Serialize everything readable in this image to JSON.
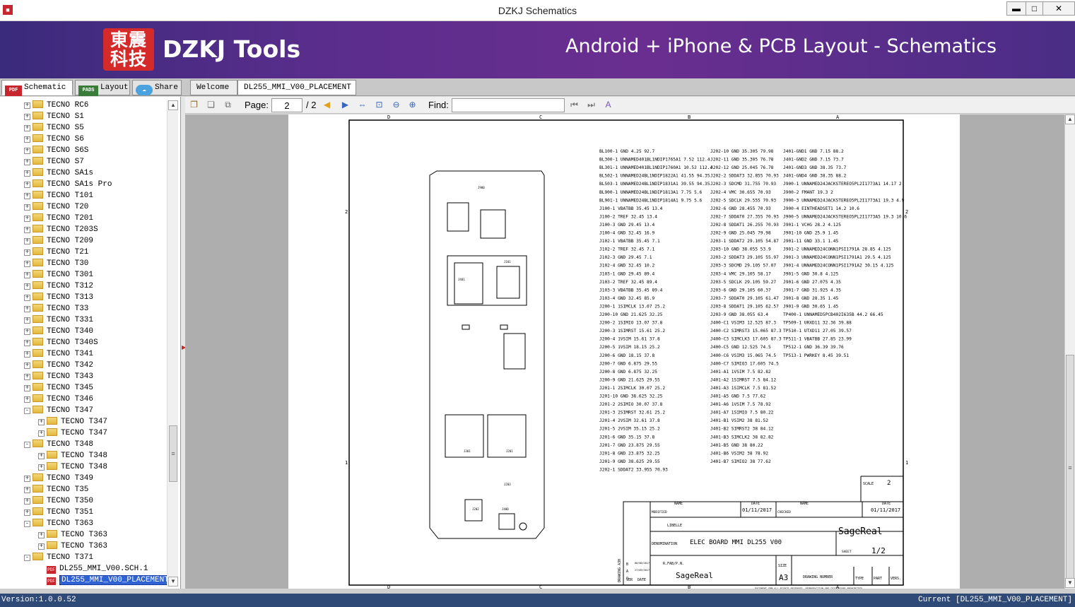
{
  "window": {
    "title": "DZKJ Schematics",
    "app_icon": "app-logo-icon",
    "minimize": "▬",
    "maximize": "□",
    "close": "✕"
  },
  "banner": {
    "logo": "東震\n科技",
    "brand": "DZKJ Tools",
    "tagline": "Android + iPhone & PCB Layout - Schematics"
  },
  "left_tabs": [
    {
      "label": "Schematic",
      "icon": "PDF",
      "active": true
    },
    {
      "label": "Layout",
      "icon": "PADS",
      "active": false
    },
    {
      "label": "Share",
      "icon": "cloud",
      "active": false
    }
  ],
  "doc_tabs": [
    {
      "label": "Welcome",
      "active": false
    },
    {
      "label": "DL255_MMI_V00_PLACEMENT",
      "active": true
    }
  ],
  "tree": [
    {
      "label": "TECNO RC6",
      "level": 0,
      "expander": "+",
      "icon": "folder"
    },
    {
      "label": "TECNO S1",
      "level": 0,
      "expander": "+",
      "icon": "folder"
    },
    {
      "label": "TECNO S5",
      "level": 0,
      "expander": "+",
      "icon": "folder"
    },
    {
      "label": "TECNO S6",
      "level": 0,
      "expander": "+",
      "icon": "folder"
    },
    {
      "label": "TECNO S6S",
      "level": 0,
      "expander": "+",
      "icon": "folder"
    },
    {
      "label": "TECNO S7",
      "level": 0,
      "expander": "+",
      "icon": "folder"
    },
    {
      "label": "TECNO SA1s",
      "level": 0,
      "expander": "+",
      "icon": "folder"
    },
    {
      "label": "TECNO SA1s Pro",
      "level": 0,
      "expander": "+",
      "icon": "folder"
    },
    {
      "label": "TECNO T101",
      "level": 0,
      "expander": "+",
      "icon": "folder"
    },
    {
      "label": "TECNO T20",
      "level": 0,
      "expander": "+",
      "icon": "folder"
    },
    {
      "label": "TECNO T201",
      "level": 0,
      "expander": "+",
      "icon": "folder"
    },
    {
      "label": "TECNO T203S",
      "level": 0,
      "expander": "+",
      "icon": "folder"
    },
    {
      "label": "TECNO T209",
      "level": 0,
      "expander": "+",
      "icon": "folder"
    },
    {
      "label": "TECNO T21",
      "level": 0,
      "expander": "+",
      "icon": "folder"
    },
    {
      "label": "TECNO T30",
      "level": 0,
      "expander": "+",
      "icon": "folder"
    },
    {
      "label": "TECNO T301",
      "level": 0,
      "expander": "+",
      "icon": "folder"
    },
    {
      "label": "TECNO T312",
      "level": 0,
      "expander": "+",
      "icon": "folder"
    },
    {
      "label": "TECNO T313",
      "level": 0,
      "expander": "+",
      "icon": "folder"
    },
    {
      "label": "TECNO T33",
      "level": 0,
      "expander": "+",
      "icon": "folder"
    },
    {
      "label": "TECNO T331",
      "level": 0,
      "expander": "+",
      "icon": "folder"
    },
    {
      "label": "TECNO T340",
      "level": 0,
      "expander": "+",
      "icon": "folder"
    },
    {
      "label": "TECNO T340S",
      "level": 0,
      "expander": "+",
      "icon": "folder"
    },
    {
      "label": "TECNO T341",
      "level": 0,
      "expander": "+",
      "icon": "folder"
    },
    {
      "label": "TECNO T342",
      "level": 0,
      "expander": "+",
      "icon": "folder"
    },
    {
      "label": "TECNO T343",
      "level": 0,
      "expander": "+",
      "icon": "folder"
    },
    {
      "label": "TECNO T345",
      "level": 0,
      "expander": "+",
      "icon": "folder"
    },
    {
      "label": "TECNO T346",
      "level": 0,
      "expander": "+",
      "icon": "folder"
    },
    {
      "label": "TECNO T347",
      "level": 0,
      "expander": "-",
      "icon": "folder"
    },
    {
      "label": "TECNO T347",
      "level": 1,
      "expander": "+",
      "icon": "folder"
    },
    {
      "label": "TECNO T347",
      "level": 1,
      "expander": "+",
      "icon": "folder"
    },
    {
      "label": "TECNO T348",
      "level": 0,
      "expander": "-",
      "icon": "folder"
    },
    {
      "label": "TECNO T348",
      "level": 1,
      "expander": "+",
      "icon": "folder"
    },
    {
      "label": "TECNO T348",
      "level": 1,
      "expander": "+",
      "icon": "folder"
    },
    {
      "label": "TECNO T349",
      "level": 0,
      "expander": "+",
      "icon": "folder"
    },
    {
      "label": "TECNO T35",
      "level": 0,
      "expander": "+",
      "icon": "folder"
    },
    {
      "label": "TECNO T350",
      "level": 0,
      "expander": "+",
      "icon": "folder"
    },
    {
      "label": "TECNO T351",
      "level": 0,
      "expander": "+",
      "icon": "folder"
    },
    {
      "label": "TECNO T363",
      "level": 0,
      "expander": "-",
      "icon": "folder"
    },
    {
      "label": "TECNO T363",
      "level": 1,
      "expander": "+",
      "icon": "folder"
    },
    {
      "label": "TECNO T363",
      "level": 1,
      "expander": "+",
      "icon": "folder"
    },
    {
      "label": "TECNO T371",
      "level": 0,
      "expander": "-",
      "icon": "folder"
    },
    {
      "label": "DL255_MMI_V00.SCH.1",
      "level": 1,
      "expander": "",
      "icon": "pdf"
    },
    {
      "label": "DL255_MMI_V00_PLACEMENT",
      "level": 1,
      "expander": "",
      "icon": "pdf",
      "selected": true
    }
  ],
  "toolbar": {
    "page_label": "Page:",
    "page_value": "2",
    "page_total": "/ 2",
    "find_label": "Find:",
    "find_value": ""
  },
  "sheet": {
    "col_markers": [
      "D",
      "C",
      "B",
      "A"
    ],
    "row_markers": [
      "2",
      "1"
    ],
    "components": [
      "J401",
      "J900",
      "J101",
      "J301",
      "J201",
      "J202",
      "J203",
      "J400"
    ],
    "netlist_col1": [
      "BL100-1 GND 4.25 92.7",
      "BL300-1 UNNAMED401BL1NDIP1765A1 7.52 112.4",
      "BL301-1 UNNAMED401BL1NDIP1760A1 10.52 112.4",
      "BL502-1 UNNAMED24BL1NDIP1822A1 41.55 94.35",
      "BL503-1 UNNAMED24BL1NDIP1831A1 39.55 94.35",
      "BL900-1 UNNAMED24BL1NDIP1813A1 7.75 5.6",
      "BL901-1 UNNAMED24BL1NDIP1814A1 9.75 5.6",
      "J100-1 VBATBB 35.45 13.4",
      "J100-2 TREF 32.45 13.4",
      "J100-3 GND 29.45 13.4",
      "J100-4 GND 32.45 16.9",
      "J102-1 VBATBB 35.45 7.1",
      "J102-2 TREF 32.45 7.1",
      "J102-3 GND 29.45 7.1",
      "J102-4 GND 32.45 10.2",
      "J103-1 GND 29.45 89.4",
      "J103-2 TREF 32.45 89.4",
      "J103-3 VBATBB 35.45 89.4",
      "J103-4 GND 32.45 85.9",
      "J200-1 1SIMCLK 13.07 25.2",
      "J200-10 GND 21.625 32.25",
      "J200-2 1SIMIO 13.07 37.8",
      "J200-3 1SIMRST 15.61 25.2",
      "J200-4 1VSIM 15.61 37.8",
      "J200-5 1VSIM 18.15 25.2",
      "J200-6 GND 18.15 37.8",
      "J200-7 GND 6.875 29.55",
      "J200-8 GND 6.875 32.25",
      "J200-9 GND 21.625 29.55",
      "J201-1 2SIMCLK 30.07 25.2",
      "J201-10 GND 38.625 32.25",
      "J201-2 2SIMIO 30.07 37.8",
      "J201-3 2SIMRST 32.61 25.2",
      "J201-4 2VSIM 32.61 37.8",
      "J201-5 2VSIM 35.15 25.2",
      "J201-6 GND 35.15 37.8",
      "J201-7 GND 23.875 29.55",
      "J201-8 GND 23.875 32.25",
      "J201-9 GND 38.625 29.55",
      "J202-1 SDDAT2 33.955 70.93"
    ],
    "netlist_col2": [
      "J202-10 GND 35.305 79.98",
      "J202-11 GND 35.305 76.78",
      "J202-12 GND 25.045 76.78",
      "J202-2 SDDAT3 32.855 70.93",
      "J202-3 SDCMD 31.755 70.93",
      "J202-4 VMC 30.655 70.93",
      "J202-5 SDCLK 29.555 70.93",
      "J202-6 GND 28.455 70.93",
      "J202-7 SDDAT0 27.355 70.93",
      "J202-8 SDDAT1 26.255 70.93",
      "J202-9 GND 25.045 79.98",
      "J203-1 SDDAT2 29.105 54.87",
      "J203-10 GND 38.055 53.9",
      "J203-2 SDDAT3 29.105 55.97",
      "J203-3 SDCMD 29.105 57.07",
      "J203-4 VMC 29.105 58.17",
      "J203-5 SDCLK 29.105 59.27",
      "J203-6 GND 29.105 60.37",
      "J203-7 SDDAT0 29.105 61.47",
      "J203-8 SDDAT1 29.105 62.57",
      "J203-9 GND 38.055 63.4",
      "J400-C1 VSIM3 12.525 87.3",
      "J400-C2 SIMRST3 15.065 87.3",
      "J400-C3 SIMCLK3 17.605 87.3",
      "J400-C5 GND 12.525 74.5",
      "J400-C6 VSIM3 15.065 74.5",
      "J400-C7 SIMIO3 17.605 74.5",
      "J401-A1 1VSIM 7.5 82.82",
      "J401-A2 1SIMRST 7.5 84.12",
      "J401-A3 1SIMCLK 7.5 81.52",
      "J401-A5 GND 7.5 77.62",
      "J401-A6 1VSIM 7.5 78.92",
      "J401-A7 1SIMIO 7.5 80.22",
      "J401-B1 VSIM2 38 81.52",
      "J401-B2 SIMRST2 38 84.12",
      "J401-B3 SIMCLK2 38 82.82",
      "J401-B5 GND 38 80.22",
      "J401-B6 VSIM2 38 78.92",
      "J401-B7 SIMIO2 38 77.62"
    ],
    "netlist_col3": [
      "J401-GND1 GND 7.15 88.2",
      "J401-GND2 GND 7.15 73.7",
      "J401-GND3 GND 38.35 73.7",
      "J401-GND4 GND 38.35 88.2",
      "J900-1 UNNAMED24JACKSTEREO5PL2I1773A1 14.17 2",
      "J900-2 FMANT 19.3 2",
      "J900-3 UNNAMED24JACKSTEREO5PL2I1773A1 19.3 4.9",
      "J900-4 EINTHEADSET1 14.2 10.6",
      "J900-5 UNNAMED24JACKSTEREO5PL2I1773A5 19.3 10.6",
      "J901-1 VCHG 28.2 4.125",
      "J901-10 GND 25.9 1.45",
      "J901-11 GND 33.1 1.45",
      "J901-2 UNNAMED24CONN1PSI1791A 28.85 4.125",
      "J901-3 UNNAMED24CONN1PSI1791A1 29.5 4.125",
      "J901-4 UNNAMED24CONN1PSI1791A2 30.15 4.125",
      "J901-5 GND 30.8 4.125",
      "J901-6 GND 27.075 4.35",
      "J901-7 GND 31.925 4.35",
      "J901-8 GND 28.35 1.45",
      "J901-9 GND 30.65 1.45",
      "TP400-1 UNNAMED5PCB402I635B 44.2 66.45",
      "TP509-1 URXD11 32.36 39.88",
      "TP510-1 UTXD11 27.05 39.57",
      "TP511-1 VBATBB 27.85 23.99",
      "TP512-1 GND 36.39 39.76",
      "TP513-1 PWRKEY 8.45 39.51"
    ],
    "title_block": {
      "scale_label": "SCALE",
      "scale_value": "2",
      "name_label": "NAME",
      "date_label": "DATE",
      "date1": "01/11/2017",
      "date2": "01/11/2017",
      "modified": "MODIFIED",
      "checked": "CHECKED",
      "libelle": "LIBELLE",
      "denomination": "DENOMINATION",
      "title": "ELEC BOARD MMI DL255 V00",
      "sheet_label": "SHEET",
      "sheet_value": "1/2",
      "brand": "SageReal",
      "drawing": "DRAWING A3H",
      "rfab": "R.FAB/P.N.",
      "size_label": "SIZE",
      "size_value": "A3",
      "drawing_number": "DRAWING NUMBER",
      "type": "TYPE",
      "part": "PART",
      "vers": "VERS.",
      "ver": "VER",
      "date_small": "DATE",
      "rev_b": "B",
      "rev_a": "A",
      "rev_o": "O",
      "rev_b_date": "00/00/2017",
      "rev_a_date": "27/09/2017",
      "rev_o_date": "01/11/2017",
      "footer": "DOCUMENT SRM ALL RIGHTS RESERVED. REPRODUCTION AND DISCLOSURE PROHIBITED"
    }
  },
  "status": {
    "left": "Version:1.0.0.52",
    "right": "Current [DL255_MMI_V00_PLACEMENT]"
  },
  "colors": {
    "banner": "#5a2d8c",
    "status": "#2f4a76",
    "selection": "#2f63d4",
    "logo": "#d42a2a"
  }
}
